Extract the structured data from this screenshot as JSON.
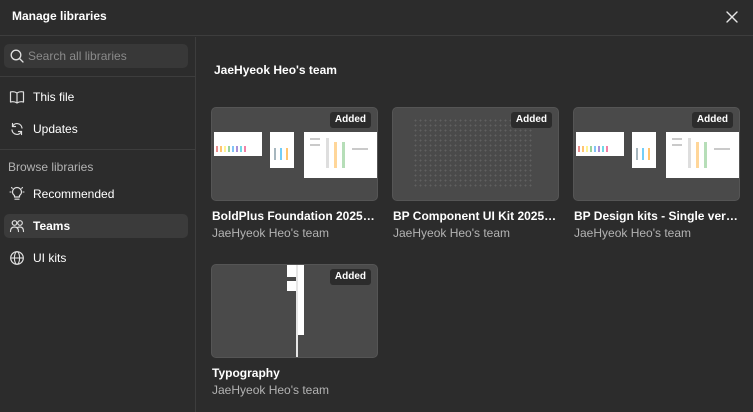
{
  "dialog": {
    "title": "Manage libraries"
  },
  "sidebar": {
    "search_placeholder": "Search all libraries",
    "top_items": [
      {
        "label": "This file",
        "icon": "book-icon"
      },
      {
        "label": "Updates",
        "icon": "refresh-icon"
      }
    ],
    "browse_heading": "Browse libraries",
    "browse_items": [
      {
        "label": "Recommended",
        "icon": "lightbulb-icon",
        "active": false
      },
      {
        "label": "Teams",
        "icon": "people-icon",
        "active": true
      },
      {
        "label": "UI kits",
        "icon": "globe-icon",
        "active": false
      }
    ]
  },
  "main": {
    "team_heading": "JaeHyeok Heo's team",
    "libraries": [
      {
        "title": "BoldPlus Foundation 2025 v1 ...",
        "owner": "JaeHyeok Heo's team",
        "badge": "Added",
        "thumb": "sheets"
      },
      {
        "title": "BP Component UI Kit 2025 (...",
        "owner": "JaeHyeok Heo's team",
        "badge": "Added",
        "thumb": "dots"
      },
      {
        "title": "BP Design kits - Single versio...",
        "owner": "JaeHyeok Heo's team",
        "badge": "Added",
        "thumb": "sheets"
      },
      {
        "title": "Typography",
        "owner": "JaeHyeok Heo's team",
        "badge": "Added",
        "thumb": "typography"
      }
    ]
  },
  "colors": {
    "background": "#2c2c2c",
    "active_item": "#3b3b3b",
    "divider": "#3d3d3d",
    "muted_text": "#b3b3b3"
  }
}
